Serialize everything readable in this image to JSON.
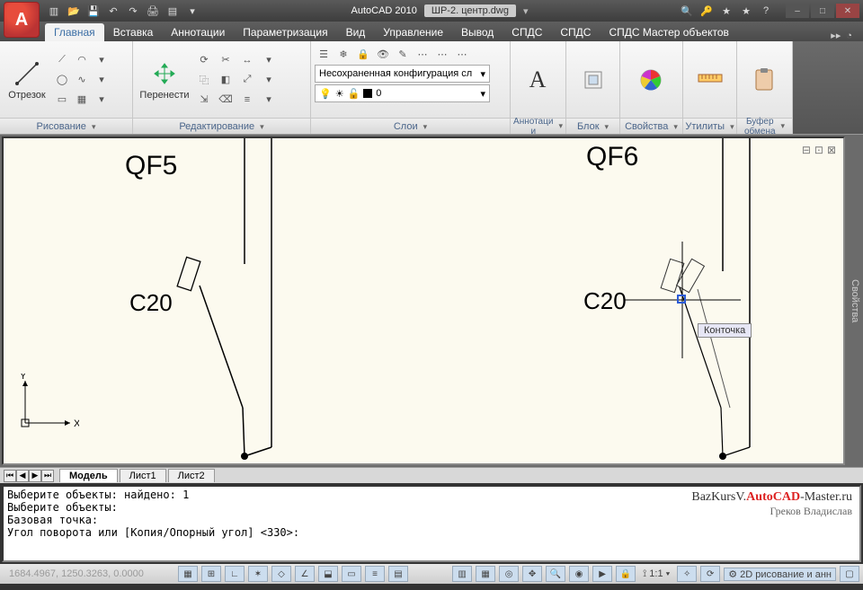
{
  "app": {
    "name": "AutoCAD 2010",
    "document": "ШР-2. центр.dwg"
  },
  "qat": [
    "new",
    "open",
    "save",
    "undo",
    "redo",
    "plot",
    "publish",
    "props",
    "match",
    "render"
  ],
  "info": [
    "binoculars",
    "key",
    "star",
    "star",
    "help"
  ],
  "winbtns": {
    "min": "–",
    "max": "□",
    "close": "✕"
  },
  "tabs": {
    "items": [
      "Главная",
      "Вставка",
      "Аннотации",
      "Параметризация",
      "Вид",
      "Управление",
      "Вывод",
      "СПДС",
      "СПДС",
      "СПДС Мастер объектов"
    ],
    "tail": "▸▸",
    "active": 0
  },
  "ribbon": {
    "draw": {
      "title": "Рисование",
      "line": "Отрезок"
    },
    "modify": {
      "title": "Редактирование",
      "move": "Перенести"
    },
    "layers": {
      "title": "Слои",
      "unsaved": "Несохраненная конфигурация сл",
      "current": "0"
    },
    "anno": {
      "title": "Аннотаци\nи",
      "btn": "Аннотации"
    },
    "block": {
      "title": "Блок",
      "btn": "Блок"
    },
    "props": {
      "title": "Свойства",
      "btn": "Свойства"
    },
    "utils": {
      "title": "Утилиты",
      "btn": "Утилиты"
    },
    "clip": {
      "title": "Буфер\nобмена",
      "btn": "Буфер обмена"
    }
  },
  "ribbon_arrow": "▾",
  "canvas": {
    "labels": {
      "qf5": "QF5",
      "qf6": "QF6",
      "c20a": "C20",
      "c20b": "C20"
    },
    "tooltip": "Конточка",
    "ucs": {
      "x": "X",
      "y": "Y"
    }
  },
  "right_strip": "Свойства",
  "sheets": {
    "items": [
      "Модель",
      "Лист1",
      "Лист2"
    ],
    "nav": [
      "⏮",
      "◀",
      "▶",
      "⏭"
    ]
  },
  "cmd": {
    "l1": "Выберите объекты: найдено: 1",
    "l2": "Выберите объекты:",
    "l3": "Базовая точка:",
    "l4": "Угол поворота или [Копия/Опорный угол] <330>:"
  },
  "watermark": {
    "pref": "BazKursV.",
    "mid": "AutoCAD",
    "suf": "-Master.ru",
    "author": "Греков Владислав"
  },
  "status": {
    "coords": "1684.4967, 1250.3263, 0.0000",
    "scale": "1:1",
    "mode": "2D рисование и анн"
  }
}
